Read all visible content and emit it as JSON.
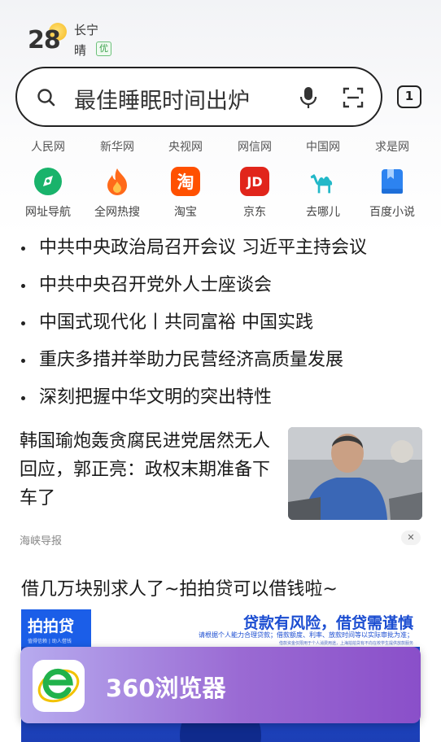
{
  "weather": {
    "temperature": "28",
    "city": "长宁",
    "condition": "晴",
    "air_quality": "优"
  },
  "search": {
    "placeholder_text": "最佳睡眠时间出炉"
  },
  "tab_count": "1",
  "sites": [
    "人民网",
    "新华网",
    "央视网",
    "网信网",
    "中国网",
    "求是网"
  ],
  "apps": [
    {
      "label": "网址导航",
      "icon": "compass-icon",
      "color": "#19b36b"
    },
    {
      "label": "全网热搜",
      "icon": "flame-icon",
      "color": "#ff6a1a"
    },
    {
      "label": "淘宝",
      "icon": "taobao-icon",
      "color": "#ff5000",
      "glyph": "淘"
    },
    {
      "label": "京东",
      "icon": "jd-icon",
      "color": "#e1251b",
      "glyph": "JD"
    },
    {
      "label": "去哪儿",
      "icon": "camel-icon",
      "color": "#22b8c8"
    },
    {
      "label": "百度小说",
      "icon": "book-icon",
      "color": "#2d83f0"
    }
  ],
  "headlines": [
    "中共中央政治局召开会议 习近平主持会议",
    "中共中央召开党外人士座谈会",
    "中国式现代化丨共同富裕 中国实践",
    "重庆多措并举助力民营经济高质量发展",
    "深刻把握中华文明的突出特性"
  ],
  "article": {
    "title": "韩国瑜炮轰贪腐民进党居然无人回应，郭正亮：政权末期准备下车了",
    "source": "海峡导报",
    "close": "✕"
  },
  "ad": {
    "title": "借几万块别求人了~拍拍贷可以借钱啦~",
    "brand": "拍拍贷",
    "brand_sub": "值得信赖 | 助人借钱",
    "warning": "贷款有风险，借贷需谨慎",
    "fine_print": "请根据个人能力合理贷款；借款额度、利率、放款时间等以实际审批为准；",
    "fine_print_2": "借款资金仅限用于个人消费用途，上海拍拍贷有不向在校学生提供放款服务"
  },
  "toast": {
    "app_name": "360浏览器"
  },
  "colors": {
    "search_border": "#222222",
    "toast_start": "#b7abef",
    "toast_end": "#8a4fc9",
    "ad_blue": "#1b4dd1"
  }
}
